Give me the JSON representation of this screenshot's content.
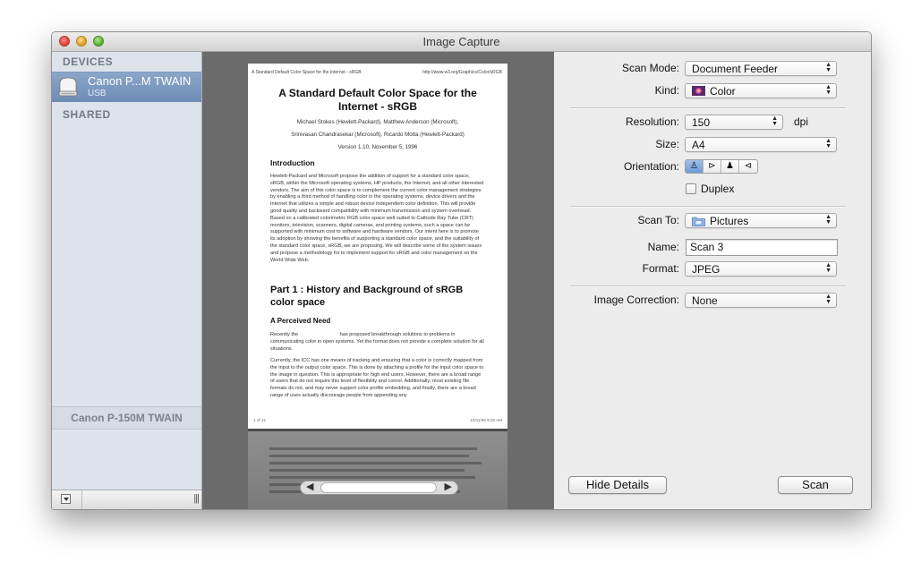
{
  "window": {
    "title": "Image Capture"
  },
  "sidebar": {
    "devices_header": "DEVICES",
    "device": {
      "name": "Canon P...M TWAIN",
      "sub": "USB"
    },
    "shared_header": "SHARED",
    "selected_device": "Canon P-150M TWAIN"
  },
  "preview": {
    "header_left": "A Standard Default Color Space for the Internet - sRGB",
    "header_right": "http://www.w3.org/Graphics/Color/sRGB",
    "title_line1": "A Standard Default Color Space for the",
    "title_line2": "Internet - sRGB",
    "authors1": "Michael Stokes (Hewlett-Packard), Matthew Anderson (Microsoft),",
    "authors2": "Srinivasan Chandrasekar (Microsoft), Ricardo Motta (Hewlett-Packard)",
    "version": "Version 1.10, November 5, 1996",
    "intro_heading": "Introduction",
    "intro_text": "Hewlett-Packard and Microsoft propose the addition of support for a standard color space, sRGB, within the Microsoft operating systems, HP products, the Internet, and all other interested vendors. The aim of this color space is to complement the current color management strategies by enabling a third method of handling color in the operating systems, device drivers and the Internet that utilizes a simple and robust device independent color definition. This will provide good quality and backward compatibility with minimum transmission and system overhead. Based on a calibrated colorimetric RGB color space well suited to Cathode Ray Tube (CRT) monitors, television, scanners, digital cameras, and printing systems, such a space can be supported with minimum cost to software and hardware vendors. Our intent here is to promote its adoption by showing the benefits of supporting a standard color space, and the suitability of the standard color space, sRGB, we are proposing. We will describe some of the system issues and propose a methodology for to implement support for sRGB and color management on the World Wide Web.",
    "part1_heading": "Part 1 : History and Background of sRGB color space",
    "perceived_heading": "A Perceived Need",
    "perceived_text": "Recently the                              has proposed breakthrough solutions to problems in communicating color in open systems. Yet the format does not provide a complete solution for all situations.",
    "icc_text": "Currently, the ICC has one means of tracking and ensuring that a color is correctly mapped from the input to the output color space. This is done by attaching a profile for the input color space to the image in question. This is appropriate for high end users. However, there are a broad range of users that do not require this level of flexibility and conrol. Additionally, most existing file formats do not, and may never support color profile embedding, and finally, there are a broad range of uses actually discourage people from appending any",
    "footer_left": "1 of 21",
    "footer_right": "10/11/98 9:25 AM"
  },
  "panel": {
    "scan_mode_label": "Scan Mode:",
    "scan_mode_value": "Document Feeder",
    "kind_label": "Kind:",
    "kind_value": "Color",
    "resolution_label": "Resolution:",
    "resolution_value": "150",
    "resolution_unit": "dpi",
    "size_label": "Size:",
    "size_value": "A4",
    "orientation_label": "Orientation:",
    "duplex_label": "Duplex",
    "duplex_checked": false,
    "scan_to_label": "Scan To:",
    "scan_to_value": "Pictures",
    "name_label": "Name:",
    "name_value": "Scan 3",
    "format_label": "Format:",
    "format_value": "JPEG",
    "image_correction_label": "Image Correction:",
    "image_correction_value": "None",
    "hide_details_label": "Hide Details",
    "scan_label": "Scan"
  },
  "colors": {
    "selection": "#7a99c0",
    "preview_bg": "#6b6b6b"
  }
}
